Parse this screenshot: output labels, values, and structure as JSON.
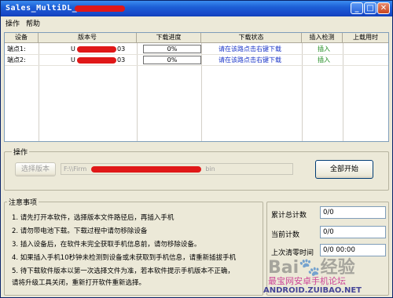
{
  "window": {
    "title": "Sales_MultiDL_"
  },
  "menu": [
    "操作",
    "帮助"
  ],
  "table": {
    "columns": [
      "设备",
      "版本号",
      "下载进度",
      "下载状态",
      "插入检测",
      "上载用时"
    ],
    "rows": [
      {
        "device": "端点1:",
        "version_prefix": "U",
        "version_suffix": "03",
        "progress": "0%",
        "progress_value": 0,
        "status": "请在该路点击右键下载",
        "insert": "插入",
        "upload_time": ""
      },
      {
        "device": "端点2:",
        "version_prefix": "U",
        "version_suffix": "03",
        "progress": "0%",
        "progress_value": 0,
        "status": "请在该路点击右键下载",
        "insert": "插入",
        "upload_time": ""
      }
    ]
  },
  "operation": {
    "group_label": "操作",
    "select_version_label": "选择版本",
    "path_prefix": "F:\\\\Firm",
    "path_suffix": "bin",
    "start_all_label": "全部开始"
  },
  "notes": {
    "group_label": "注意事项",
    "items": [
      "1.  请先打开本软件，选择版本文件路径后，再插入手机",
      "2.  请勿带电池下载。下载过程中请勿移除设备",
      "3.  插入设备后，在软件未完全获取手机信息前，请勿移除设备。",
      "4.  如果插入手机10秒钟未检测到设备或未获取到手机信息，请重新插拔手机",
      "5.  待下载软件版本以第一次选择文件为准，若本软件提示手机版本不正确，",
      "     请将升级工具关闭，重新打开软件重新选择。"
    ]
  },
  "stats": {
    "total_label": "累计总计数",
    "total_value": "0/0",
    "current_label": "当前计数",
    "current_value": "0/0",
    "last_clear_label": "上次清零时间",
    "last_clear_value": "0/0 00:00"
  },
  "watermark": {
    "baidu": "Bai",
    "jingyan": "经验",
    "forum": "最宝网安卓手机论坛",
    "site": "ANDROID.ZUIBAO.NET"
  },
  "colors": {
    "redaction": "#e01818",
    "titlebar": "#1d5fd6",
    "status_text": "#1a35c8",
    "insert_text": "#1c8a1c"
  }
}
